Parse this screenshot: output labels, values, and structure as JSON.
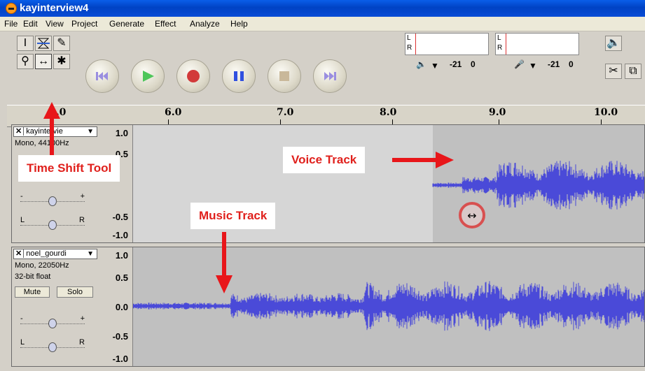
{
  "window": {
    "title": "kayinterview4"
  },
  "menu": [
    "File",
    "Edit",
    "View",
    "Project",
    "Generate",
    "Effect",
    "Analyze",
    "Help"
  ],
  "meters": {
    "left_label": "L",
    "right_label": "R",
    "output_level": "-21",
    "output_zero": "0",
    "input_level": "-21",
    "input_zero": "0"
  },
  "ruler": {
    "labels": [
      "5.0",
      "6.0",
      "7.0",
      "8.0",
      "9.0",
      "10.0"
    ]
  },
  "tracks": [
    {
      "name": "kayintervie",
      "info": "Mono, 44100Hz",
      "scale": [
        "1.0",
        "0.5",
        "-0.5",
        "-1.0"
      ],
      "pan_left": "L",
      "pan_right": "R",
      "gain_minus": "-",
      "gain_plus": "+"
    },
    {
      "name": "noel_gourdi",
      "info": "Mono, 22050Hz",
      "format": "32-bit float",
      "mute": "Mute",
      "solo": "Solo",
      "scale": [
        "1.0",
        "0.5",
        "0.0",
        "-0.5",
        "-1.0"
      ],
      "pan_left": "L",
      "pan_right": "R",
      "gain_minus": "-",
      "gain_plus": "+"
    }
  ],
  "annotations": {
    "time_shift": "Time Shift Tool",
    "voice_track": "Voice Track",
    "music_track": "Music Track"
  },
  "colors": {
    "title_bar": "#0a4cd6",
    "waveform": "#4a4ad8",
    "annotation_text": "#e0201c",
    "arrow": "#e8161a"
  }
}
